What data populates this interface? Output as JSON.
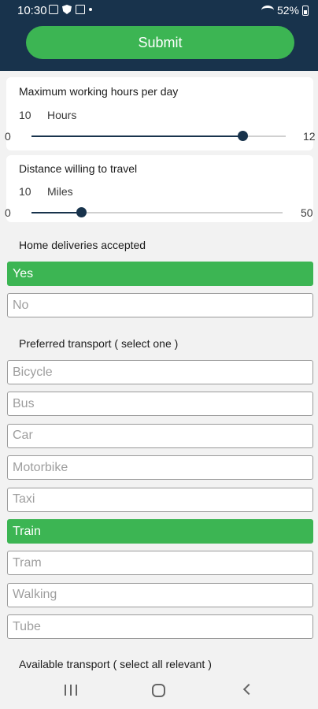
{
  "status_bar": {
    "time": "10:30",
    "battery": "52%"
  },
  "submit_label": "Submit",
  "working_hours": {
    "title": "Maximum working hours per day",
    "value": "10",
    "unit": "Hours",
    "min": "0",
    "max": "12",
    "level": 0.83
  },
  "distance": {
    "title": "Distance willing to travel",
    "value": "10",
    "unit": "Miles",
    "min": "0",
    "max": "50",
    "level": 0.2
  },
  "home_deliveries": {
    "title": "Home deliveries accepted",
    "options": [
      {
        "label": "Yes",
        "selected": true
      },
      {
        "label": "No",
        "selected": false
      }
    ]
  },
  "preferred_transport": {
    "title": "Preferred transport ( select one )",
    "options": [
      {
        "label": "Bicycle",
        "selected": false
      },
      {
        "label": "Bus",
        "selected": false
      },
      {
        "label": "Car",
        "selected": false
      },
      {
        "label": "Motorbike",
        "selected": false
      },
      {
        "label": "Taxi",
        "selected": false
      },
      {
        "label": "Train",
        "selected": true
      },
      {
        "label": "Tram",
        "selected": false
      },
      {
        "label": "Walking",
        "selected": false
      },
      {
        "label": "Tube",
        "selected": false
      }
    ]
  },
  "available_transport": {
    "title": "Available transport ( select all relevant )"
  },
  "colors": {
    "header": "#18334c",
    "accent": "#3cb553"
  }
}
